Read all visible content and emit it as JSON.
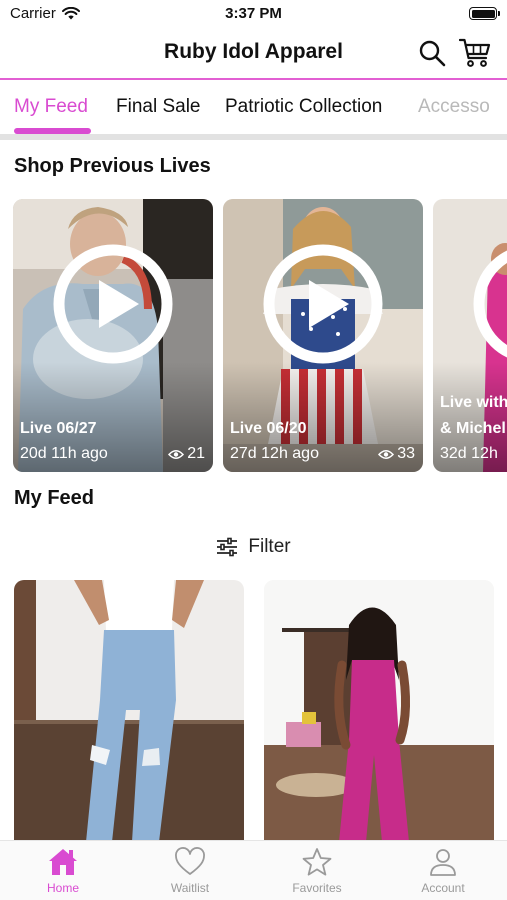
{
  "status_bar": {
    "carrier": "Carrier",
    "time": "3:37 PM"
  },
  "header": {
    "title": "Ruby Idol Apparel"
  },
  "tabs": [
    {
      "label": "My Feed",
      "active": true
    },
    {
      "label": "Final Sale"
    },
    {
      "label": "Patriotic Collection"
    },
    {
      "label": "Accesso"
    }
  ],
  "lives_section": {
    "title": "Shop Previous Lives"
  },
  "lives": [
    {
      "title": "Live 06/27",
      "ago": "20d 11h ago",
      "views": "21"
    },
    {
      "title": "Live 06/20",
      "ago": "27d 12h ago",
      "views": "33"
    },
    {
      "title": "Live with",
      "title2": "& Michel",
      "ago": "32d 12h"
    }
  ],
  "feed_section": {
    "title": "My Feed"
  },
  "filter": {
    "label": "Filter"
  },
  "bottom_nav": [
    {
      "label": "Home",
      "icon": "home-icon",
      "active": true
    },
    {
      "label": "Waitlist",
      "icon": "heart-icon"
    },
    {
      "label": "Favorites",
      "icon": "star-icon"
    },
    {
      "label": "Account",
      "icon": "account-icon"
    }
  ],
  "colors": {
    "accent": "#d94bd1",
    "inactive": "#9a9a9a"
  }
}
